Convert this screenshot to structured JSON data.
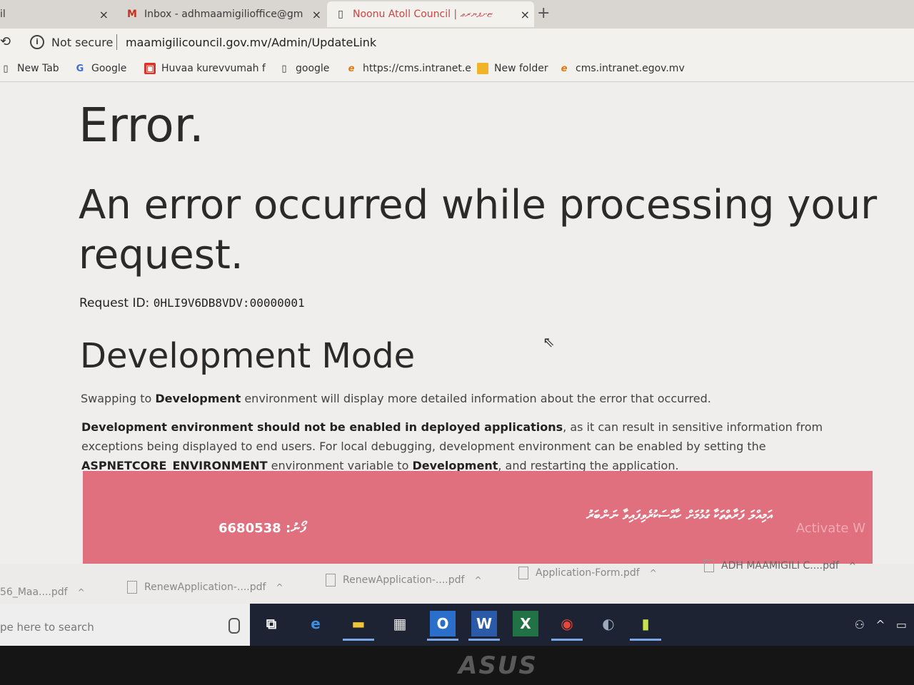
{
  "browser": {
    "tabs": [
      {
        "label": "il",
        "icon": ""
      },
      {
        "label": "Inbox - adhmaamigilioffice@gm",
        "icon": "M"
      },
      {
        "label": "Noonu Atoll Council | ޏށޕޔރޢ",
        "icon": "▯"
      }
    ],
    "new_tab_symbol": "+",
    "close_symbol": "×",
    "security_label": "Not secure",
    "url": "maamigilicouncil.gov.mv/Admin/UpdateLink",
    "bookmarks": [
      {
        "label": "New Tab",
        "icon": "page-icon"
      },
      {
        "label": "Google",
        "icon": "google-icon",
        "glyph": "G"
      },
      {
        "label": "Huvaa kurevvumah f",
        "icon": "app-icon",
        "glyph": "▣"
      },
      {
        "label": "google",
        "icon": "page-icon"
      },
      {
        "label": "https://cms.intranet.e",
        "icon": "ie-icon",
        "glyph": "e"
      },
      {
        "label": "New folder",
        "icon": "folder-icon"
      },
      {
        "label": "cms.intranet.egov.mv",
        "icon": "ie-icon",
        "glyph": "e"
      }
    ]
  },
  "page": {
    "title": "Error.",
    "message": "An error occurred while processing your request.",
    "request_id_label": "Request ID:",
    "request_id": "0HLI9V6DB8VDV:00000001",
    "dev_heading": "Development Mode",
    "p1_pre": "Swapping to ",
    "p1_bold": "Development",
    "p1_post": " environment will display more detailed information about the error that occurred.",
    "p2_bold1": "Development environment should not be enabled in deployed applications",
    "p2_mid1": ", as it can result in sensitive information from exceptions being displayed to end users. For local debugging, development environment can be enabled by setting the ",
    "p2_bold2": "ASPNETCORE_ENVIRONMENT",
    "p2_mid2": " environment variable to ",
    "p2_bold3": "Development",
    "p2_post": ", and restarting the application.",
    "banner_phone": "6680538 :ފޯނު",
    "banner_dv": "އަމިއްލަ ފަރާތްތަކާ ގުޅުމަށް ހާއްސަކުރެވިފައިވާ ނަންބަރު",
    "banner_activate": "Activate W",
    "banner_color": "#e0707e"
  },
  "downloads": [
    {
      "label": "56_Maa....pdf"
    },
    {
      "label": "RenewApplication-....pdf"
    },
    {
      "label": "RenewApplication-....pdf"
    },
    {
      "label": "Application-Form.pdf"
    },
    {
      "label": "ADH MAAMIGILI C....pdf"
    }
  ],
  "taskbar": {
    "search_placeholder": "pe here to search",
    "apps": [
      {
        "name": "task-view-icon",
        "glyph": "⧉"
      },
      {
        "name": "edge-icon",
        "glyph": "e"
      },
      {
        "name": "file-explorer-icon",
        "glyph": "▬"
      },
      {
        "name": "store-icon",
        "glyph": "▦"
      },
      {
        "name": "outlook-icon",
        "glyph": "O"
      },
      {
        "name": "word-icon",
        "glyph": "W"
      },
      {
        "name": "excel-icon",
        "glyph": "X"
      },
      {
        "name": "chrome-icon",
        "glyph": "◉"
      },
      {
        "name": "app-icon",
        "glyph": "◐"
      },
      {
        "name": "app-icon-2",
        "glyph": "▮"
      }
    ]
  },
  "monitor_brand": "ASUS"
}
